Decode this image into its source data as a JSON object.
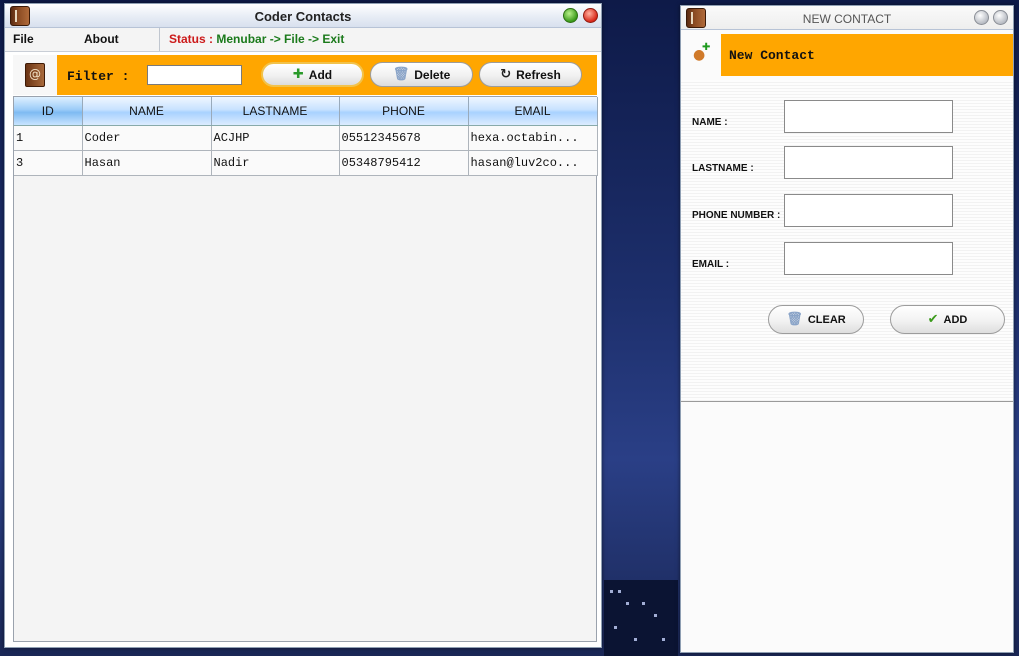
{
  "colors": {
    "accent_orange": "#ffa600",
    "status_label": "#cc1a1a",
    "status_value": "#1b7a1b"
  },
  "main_window": {
    "title": "Coder Contacts",
    "menu": {
      "file": "File",
      "about": "About"
    },
    "status": {
      "label": "Status :",
      "value": "Menubar -> File -> Exit"
    },
    "toolbar": {
      "filter_label": "Filter :",
      "filter_value": "",
      "add_label": "Add",
      "delete_label": "Delete",
      "refresh_label": "Refresh"
    },
    "table": {
      "columns": [
        "ID",
        "NAME",
        "LASTNAME",
        "PHONE",
        "EMAIL"
      ],
      "rows": [
        [
          "1",
          "Coder",
          "ACJHP",
          "05512345678",
          "hexa.octabin..."
        ],
        [
          "3",
          "Hasan",
          "Nadir",
          "05348795412",
          "hasan@luv2co..."
        ]
      ]
    }
  },
  "new_contact_window": {
    "title": "NEW CONTACT",
    "header": "New Contact",
    "fields": {
      "name_label": "NAME :",
      "lastname_label": "LASTNAME :",
      "phone_label": "PHONE NUMBER :",
      "email_label": "EMAIL :"
    },
    "buttons": {
      "clear": "CLEAR",
      "add": "ADD"
    }
  }
}
